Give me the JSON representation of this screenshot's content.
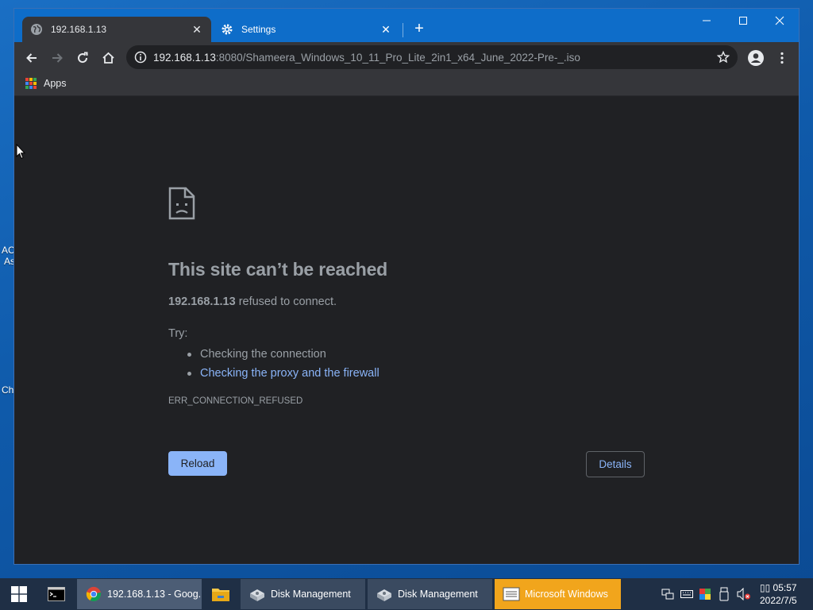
{
  "desktop": {
    "fragments": [
      "AC",
      "As",
      "Ch"
    ]
  },
  "tabs": [
    {
      "title": "192.168.1.13",
      "icon": "globe-icon",
      "active": true
    },
    {
      "title": "Settings",
      "icon": "gear-icon",
      "active": false
    }
  ],
  "window_controls": {
    "minimize": "–",
    "maximize": "☐",
    "close": "✕"
  },
  "new_tab": "+",
  "omnibox": {
    "host": "192.168.1.13",
    "path": ":8080/Shameera_Windows_10_11_Pro_Lite_2in1_x64_June_2022-Pre-_.iso"
  },
  "bookmarks": {
    "apps_label": "Apps"
  },
  "error_page": {
    "title": "This site can’t be reached",
    "host": "192.168.1.13",
    "desc_suffix": " refused to connect.",
    "try_label": "Try:",
    "suggestions": [
      {
        "text": "Checking the connection",
        "link": false
      },
      {
        "text": "Checking the proxy and the firewall",
        "link": true
      }
    ],
    "error_code": "ERR_CONNECTION_REFUSED",
    "reload_label": "Reload",
    "details_label": "Details"
  },
  "taskbar": {
    "buttons": [
      {
        "label": "192.168.1.13 - Goog...",
        "icon": "chrome-icon"
      },
      {
        "label": "Disk Management",
        "icon": "disk-management-icon"
      },
      {
        "label": "Disk Management",
        "icon": "disk-management-icon"
      },
      {
        "label": "Microsoft Windows",
        "icon": "window-list-icon"
      }
    ],
    "clock": {
      "time": "▯▯ 05:57",
      "date": "2022/7/5"
    }
  },
  "colors": {
    "tab_strip": "#0e6dc9",
    "toolbar": "#35363a",
    "page_bg": "#202124",
    "link": "#8ab4f8",
    "taskbar": "#1f2f45",
    "taskbar_highlight": "#f1a51c"
  }
}
